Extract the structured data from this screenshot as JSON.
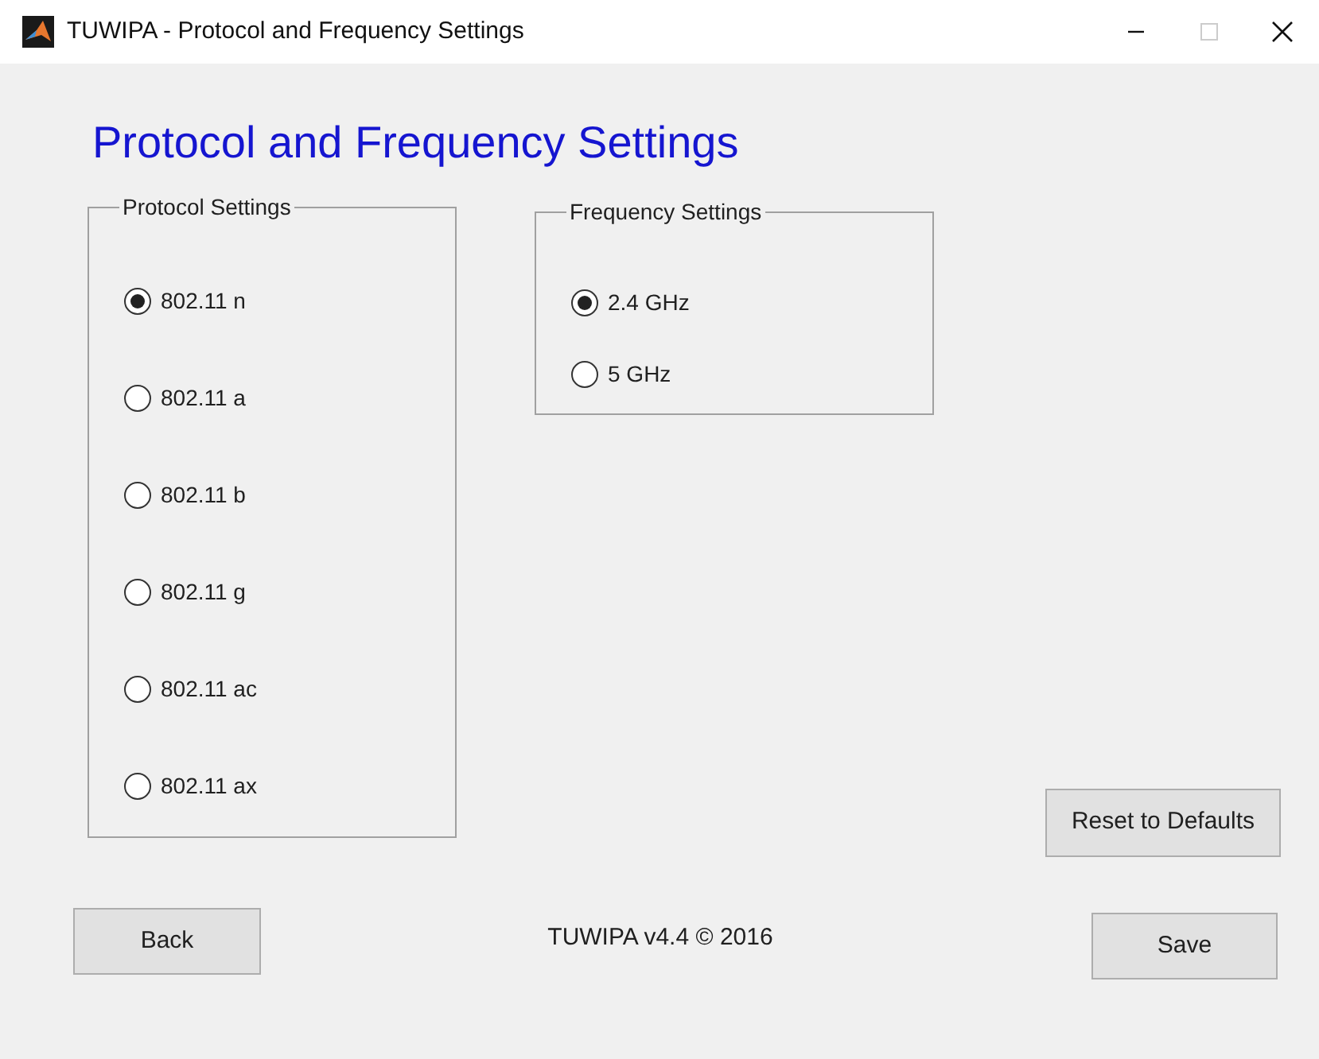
{
  "window": {
    "title": "TUWIPA - Protocol and Frequency Settings"
  },
  "heading": "Protocol and Frequency Settings",
  "protocol_settings": {
    "title": "Protocol Settings",
    "options": [
      {
        "label": "802.11 n",
        "selected": true
      },
      {
        "label": "802.11 a",
        "selected": false
      },
      {
        "label": "802.11 b",
        "selected": false
      },
      {
        "label": "802.11 g",
        "selected": false
      },
      {
        "label": "802.11 ac",
        "selected": false
      },
      {
        "label": "802.11 ax",
        "selected": false
      }
    ]
  },
  "frequency_settings": {
    "title": "Frequency  Settings",
    "options": [
      {
        "label": "2.4 GHz",
        "selected": true
      },
      {
        "label": "5 GHz",
        "selected": false
      }
    ]
  },
  "buttons": {
    "reset": "Reset to Defaults",
    "back": "Back",
    "save": "Save"
  },
  "footer": "TUWIPA v4.4 © 2016"
}
